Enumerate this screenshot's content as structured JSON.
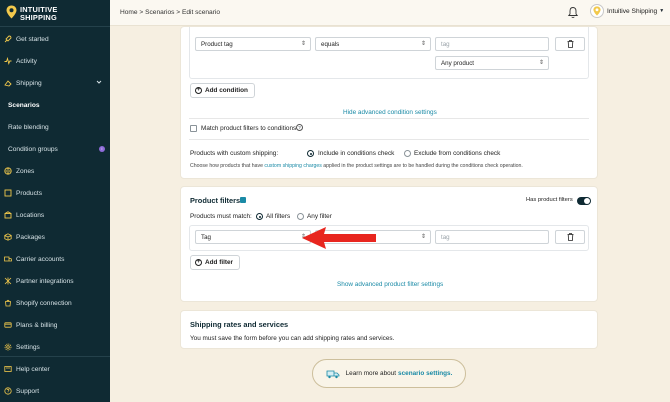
{
  "brand": {
    "line1": "INTUITIVE",
    "line2": "SHIPPING"
  },
  "sidebar": {
    "items": [
      {
        "label": "Get started",
        "icon": "rocket-icon"
      },
      {
        "label": "Activity",
        "icon": "activity-icon"
      },
      {
        "label": "Shipping",
        "icon": "truck-icon"
      },
      {
        "label": "Scenarios",
        "icon": ""
      },
      {
        "label": "Rate blending",
        "icon": ""
      },
      {
        "label": "Condition groups",
        "icon": ""
      },
      {
        "label": "Zones",
        "icon": "globe-icon"
      },
      {
        "label": "Products",
        "icon": "box-icon"
      },
      {
        "label": "Locations",
        "icon": "location-icon"
      },
      {
        "label": "Packages",
        "icon": "package-icon"
      },
      {
        "label": "Carrier accounts",
        "icon": "carrier-icon"
      },
      {
        "label": "Partner integrations",
        "icon": "integration-icon"
      },
      {
        "label": "Shopify connection",
        "icon": "shopify-icon"
      },
      {
        "label": "Plans & billing",
        "icon": "billing-icon"
      },
      {
        "label": "Settings",
        "icon": "gear-icon"
      }
    ],
    "bottom": [
      {
        "label": "Help center",
        "icon": "help-icon"
      },
      {
        "label": "Support",
        "icon": "support-icon"
      }
    ],
    "badge": "i"
  },
  "header": {
    "breadcrumb": "Home > Scenarios > Edit scenario",
    "account": "Intuitive Shipping"
  },
  "conditions": {
    "field": "Product tag",
    "operator": "equals",
    "value_placeholder": "tag",
    "any_product": "Any product",
    "add_condition": "Add condition",
    "hide_advanced": "Hide advanced condition settings",
    "match_filters": "Match product filters to conditions",
    "custom_shipping_label": "Products with custom shipping:",
    "include_option": "Include in conditions check",
    "exclude_option": "Exclude from conditions check",
    "note_pre": "Choose how products that have",
    "note_link": "custom shipping charges",
    "note_post": "applied in the product settings are to be handled during the conditions check operation."
  },
  "product_filters": {
    "title": "Product filters",
    "has_filters": "Has product filters",
    "must_match": "Products must match:",
    "all_filters": "All filters",
    "any_filter": "Any filter",
    "field": "Tag",
    "value_placeholder": "tag",
    "add_filter": "Add filter",
    "show_advanced": "Show advanced product filter settings"
  },
  "rates": {
    "title": "Shipping rates and services",
    "note": "You must save the form before you can add shipping rates and services."
  },
  "learn": {
    "pre": "Learn more about",
    "link": "scenario settings."
  },
  "colors": {
    "sidebar": "#0f2a33",
    "accent": "#1a8aa6",
    "arrow": "#e8261f",
    "background": "#f6efe1"
  }
}
